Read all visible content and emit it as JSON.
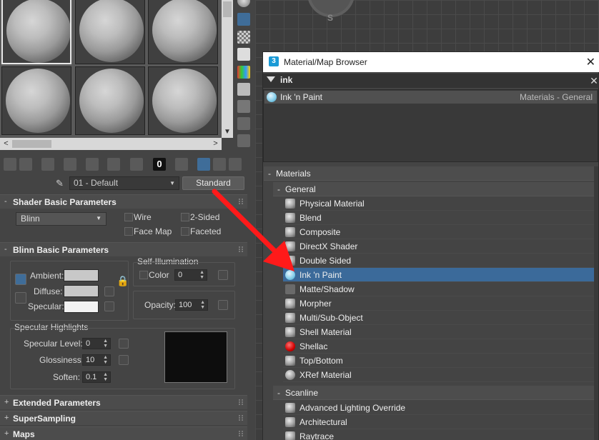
{
  "editor": {
    "material_name": "01 - Default",
    "type_button": "Standard",
    "toolbar_digit": "0",
    "rollouts": {
      "shader_basic": {
        "title": "Shader Basic Parameters",
        "shader": "Blinn",
        "wire": "Wire",
        "two_sided": "2-Sided",
        "face_map": "Face Map",
        "faceted": "Faceted"
      },
      "blinn_basic": {
        "title": "Blinn Basic Parameters",
        "self_illum_title": "Self-Illumination",
        "color_label": "Color",
        "color_value": "0",
        "ambient": "Ambient:",
        "diffuse": "Diffuse:",
        "specular": "Specular:",
        "opacity_label": "Opacity:",
        "opacity_value": "100",
        "spec_highlights_title": "Specular Highlights",
        "spec_level_label": "Specular Level:",
        "spec_level_value": "0",
        "glossiness_label": "Glossiness:",
        "glossiness_value": "10",
        "soften_label": "Soften:",
        "soften_value": "0.1"
      },
      "extended": {
        "title": "Extended Parameters"
      },
      "supersampling": {
        "title": "SuperSampling"
      },
      "maps": {
        "title": "Maps"
      }
    },
    "colors": {
      "ambient": "#c8c8c8",
      "diffuse": "#c8c8c8",
      "specular": "#f2f2f2",
      "highlight_preview": "#0d0d0d"
    }
  },
  "viewport": {
    "node_label": "S"
  },
  "browser": {
    "app_icon": "3",
    "title": "Material/Map Browser",
    "search_query": "ink",
    "result": {
      "name": "Ink 'n Paint",
      "category": "Materials - General"
    },
    "materials_header": "Materials",
    "general_header": "General",
    "general_items": [
      "Physical Material",
      "Blend",
      "Composite",
      "DirectX Shader",
      "Double Sided",
      "Ink 'n Paint",
      "Matte/Shadow",
      "Morpher",
      "Multi/Sub-Object",
      "Shell Material",
      "Shellac",
      "Top/Bottom",
      "XRef Material"
    ],
    "scanline_header": "Scanline",
    "scanline_items": [
      "Advanced Lighting Override",
      "Architectural",
      "Raytrace"
    ],
    "selected_item": "Ink 'n Paint",
    "colors": {
      "selected": "#3b6a9a",
      "annotation_arrow": "#ff1a1a"
    }
  }
}
